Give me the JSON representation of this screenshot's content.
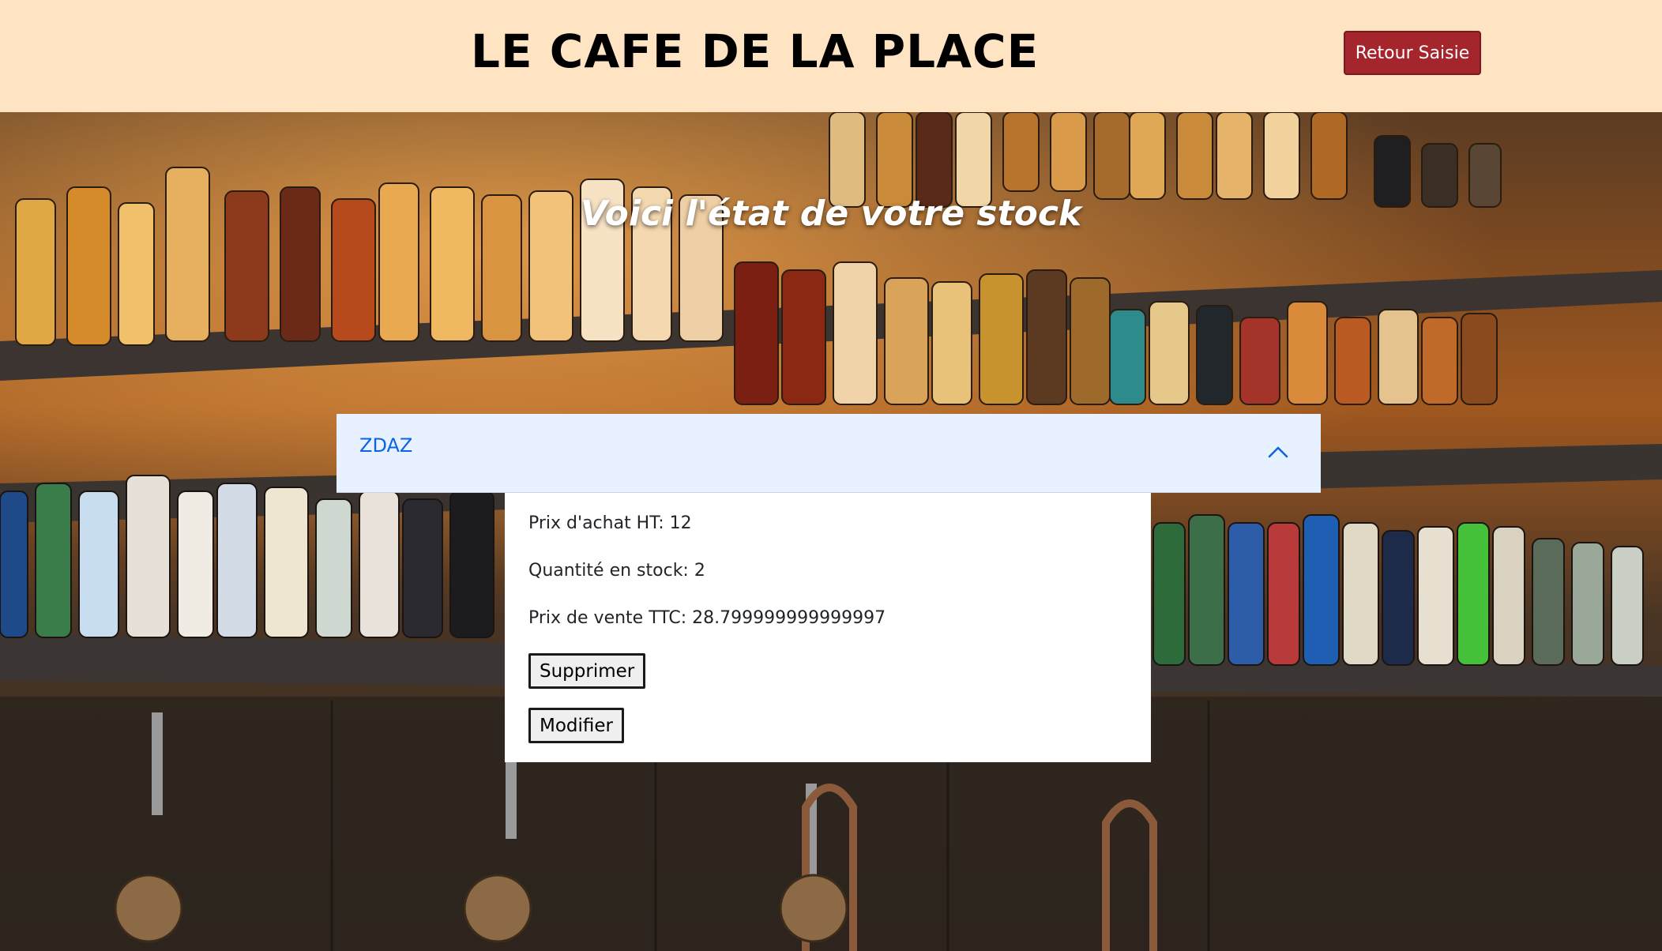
{
  "header": {
    "title": "LE CAFE DE LA PLACE",
    "back_label": "Retour Saisie",
    "background_color": "#ffe4c4",
    "button_color": "#a4262c"
  },
  "heading": "Voici l'état de votre stock",
  "stock_item": {
    "name": "ZDAZ",
    "expanded": true,
    "purchase_price": "Prix d'achat HT: 12",
    "quantity": "Quantité en stock: 2",
    "sale_price": "Prix de vente TTC: 28.799999999999997",
    "delete_label": "Supprimer",
    "edit_label": "Modifier"
  },
  "icons": {
    "accordion_toggle": "chevron-up-icon"
  }
}
